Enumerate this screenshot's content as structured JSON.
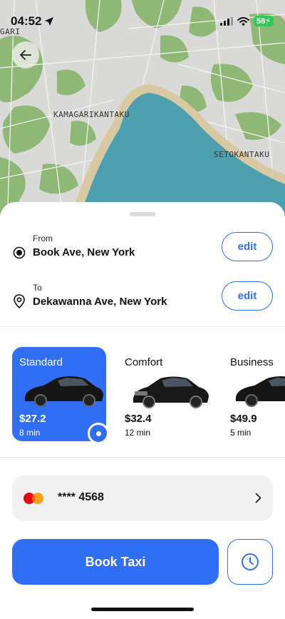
{
  "status_bar": {
    "time": "04:52",
    "battery": "58"
  },
  "map": {
    "labels": {
      "kamagari": "KAMAGARIKANTAKU",
      "seto": "SETOKANTAKU",
      "edge": "GARI"
    },
    "colors": {
      "land": "#d9d9d7",
      "water": "#4e9fb0",
      "beach": "#d8c9a3",
      "park": "#8fb775"
    }
  },
  "route": {
    "from": {
      "label": "From",
      "address": "Book Ave, New York",
      "edit_label": "edit"
    },
    "to": {
      "label": "To",
      "address": "Dekawanna Ave, New York",
      "edit_label": "edit"
    }
  },
  "car_options": [
    {
      "name": "Standard",
      "price": "$27.2",
      "eta": "8 min",
      "selected": true
    },
    {
      "name": "Comfort",
      "price": "$32.4",
      "eta": "12 min",
      "selected": false
    },
    {
      "name": "Business",
      "price": "$49.9",
      "eta": "5 min",
      "selected": false
    }
  ],
  "payment": {
    "card_masked": "**** 4568",
    "brand_icon": "mastercard-icon"
  },
  "actions": {
    "book_label": "Book Taxi",
    "schedule_icon": "clock-icon"
  },
  "accent_color": "#2f6ef5"
}
